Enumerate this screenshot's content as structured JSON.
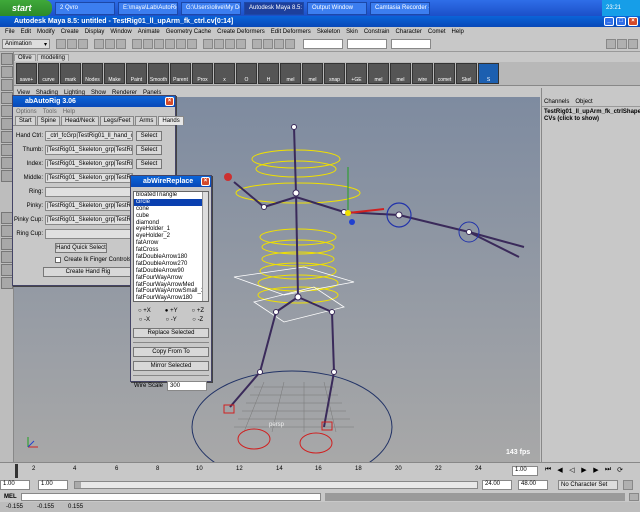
{
  "taskbar": {
    "start": "start",
    "tasks": [
      "2 Qvro",
      "E:\\maya\\Lab\\AutoRig_3",
      "G:\\Users\\olive\\My Do",
      "Autodesk Maya 8.5:",
      "Output Window",
      "Camtasia Recorder -"
    ],
    "clock": "23:21"
  },
  "maya": {
    "title": "Autodesk Maya 8.5: untitled   - TestRig01_ll_upArm_fk_ctrl.cv[0:14]",
    "menus": [
      "File",
      "Edit",
      "Modify",
      "Create",
      "Display",
      "Window",
      "Animate",
      "Geometry Cache",
      "Create Deformers",
      "Edit Deformers",
      "Skeleton",
      "Skin",
      "Constrain",
      "Character",
      "Comet",
      "Help"
    ],
    "mode": "Animation",
    "shelf_tabs": [
      "Olive",
      "modeling"
    ],
    "shelf_items": [
      "save+",
      "curve",
      "mark",
      "Nodes",
      "Make",
      "Paint",
      "Smooth",
      "Parent",
      "Prox",
      "x",
      "O",
      "H",
      "mel",
      "mel",
      "snap",
      "+GE",
      "mel",
      "mel",
      "wire",
      "comet",
      "Skel",
      "S"
    ],
    "panel_menus": [
      "View",
      "Shading",
      "Lighting",
      "Show",
      "Renderer",
      "Panels"
    ],
    "viewport": {
      "camera": "persp",
      "fps": "143 fps"
    },
    "channel_tabs": [
      "Channels",
      "Object"
    ],
    "channel_object": "TestRig01_ll_upArm_fk_ctrlShape",
    "channel_note": "CVs (click to show)",
    "timeline": {
      "ticks": [
        "2",
        "4",
        "6",
        "8",
        "10",
        "12",
        "14",
        "16",
        "18",
        "20",
        "22",
        "24"
      ],
      "current": "1.00"
    },
    "range": {
      "start": "1.00",
      "inner_start": "1.00",
      "inner_end": "24.00",
      "end": "48.00",
      "char_set": "No Character Set"
    },
    "mel_label": "MEL",
    "help_values": [
      "-0.155",
      "-0.155",
      "0.155"
    ]
  },
  "autorig": {
    "title": "abAutoRig 3.06",
    "menus": [
      "Options",
      "Tools",
      "Help"
    ],
    "tabs": [
      "Start",
      "Spine",
      "Head/Neck",
      "Legs/Feet",
      "Arms",
      "Hands"
    ],
    "active_tab": "Hands",
    "rows": [
      {
        "label": "Hand Ctrl:",
        "value": "_ctrl_fcGrp|TestRig01_ll_hand_ctrl",
        "button": "Select"
      },
      {
        "label": "Thumb:",
        "value": "|TestRig01_Skeleton_grp|TestRig0",
        "button": "Select"
      },
      {
        "label": "Index:",
        "value": "|TestRig01_Skeleton_grp|TestRig0",
        "button": "Select"
      },
      {
        "label": "Middle:",
        "value": "|TestRig01_Skeleton_grp|TestRig0",
        "button": ""
      },
      {
        "label": "Ring:",
        "value": "",
        "button": ""
      },
      {
        "label": "Pinky:",
        "value": "|TestRig01_Skeleton_grp|TestRig0",
        "button": ""
      },
      {
        "label": "Pinky Cup:",
        "value": "|TestRig01_Skeleton_grp|TestRig0",
        "button": ""
      },
      {
        "label": "Ring Cup:",
        "value": "",
        "button": ""
      }
    ],
    "quick_select": "Hand Quick Select",
    "ik_checkbox": "Create Ik Finger Controls",
    "create_btn": "Create Hand Rig"
  },
  "wirereplace": {
    "title": "abWireReplace",
    "items": [
      "bloatedTriangle",
      "circle",
      "cone",
      "cube",
      "diamond",
      "eyeHolder_1",
      "eyeHolder_2",
      "fatArrow",
      "fatCross",
      "fatDoubleArrow180",
      "fatDoubleArrow270",
      "fatDoubleArrow90",
      "fatFourWayArrow",
      "fatFourWayArrowMed",
      "fatFourWayArrowSmall_1",
      "fatFourWayArrow180"
    ],
    "selected": "circle",
    "axes": [
      [
        "+X",
        "+Y",
        "+Z"
      ],
      [
        "-X",
        "-Y",
        "-Z"
      ]
    ],
    "replace_btn": "Replace Selected",
    "copy_btn": "Copy From To",
    "mirror_btn": "Mirror Selected",
    "scale_label": "Wire Scale",
    "scale_value": "300"
  },
  "colors": {
    "titlebar": "#0a64d8",
    "start": "#3fa93a",
    "viewport_top": "#7e8ba0",
    "viewport_bottom": "#a8a8a8",
    "selection": "#0a40b0"
  }
}
